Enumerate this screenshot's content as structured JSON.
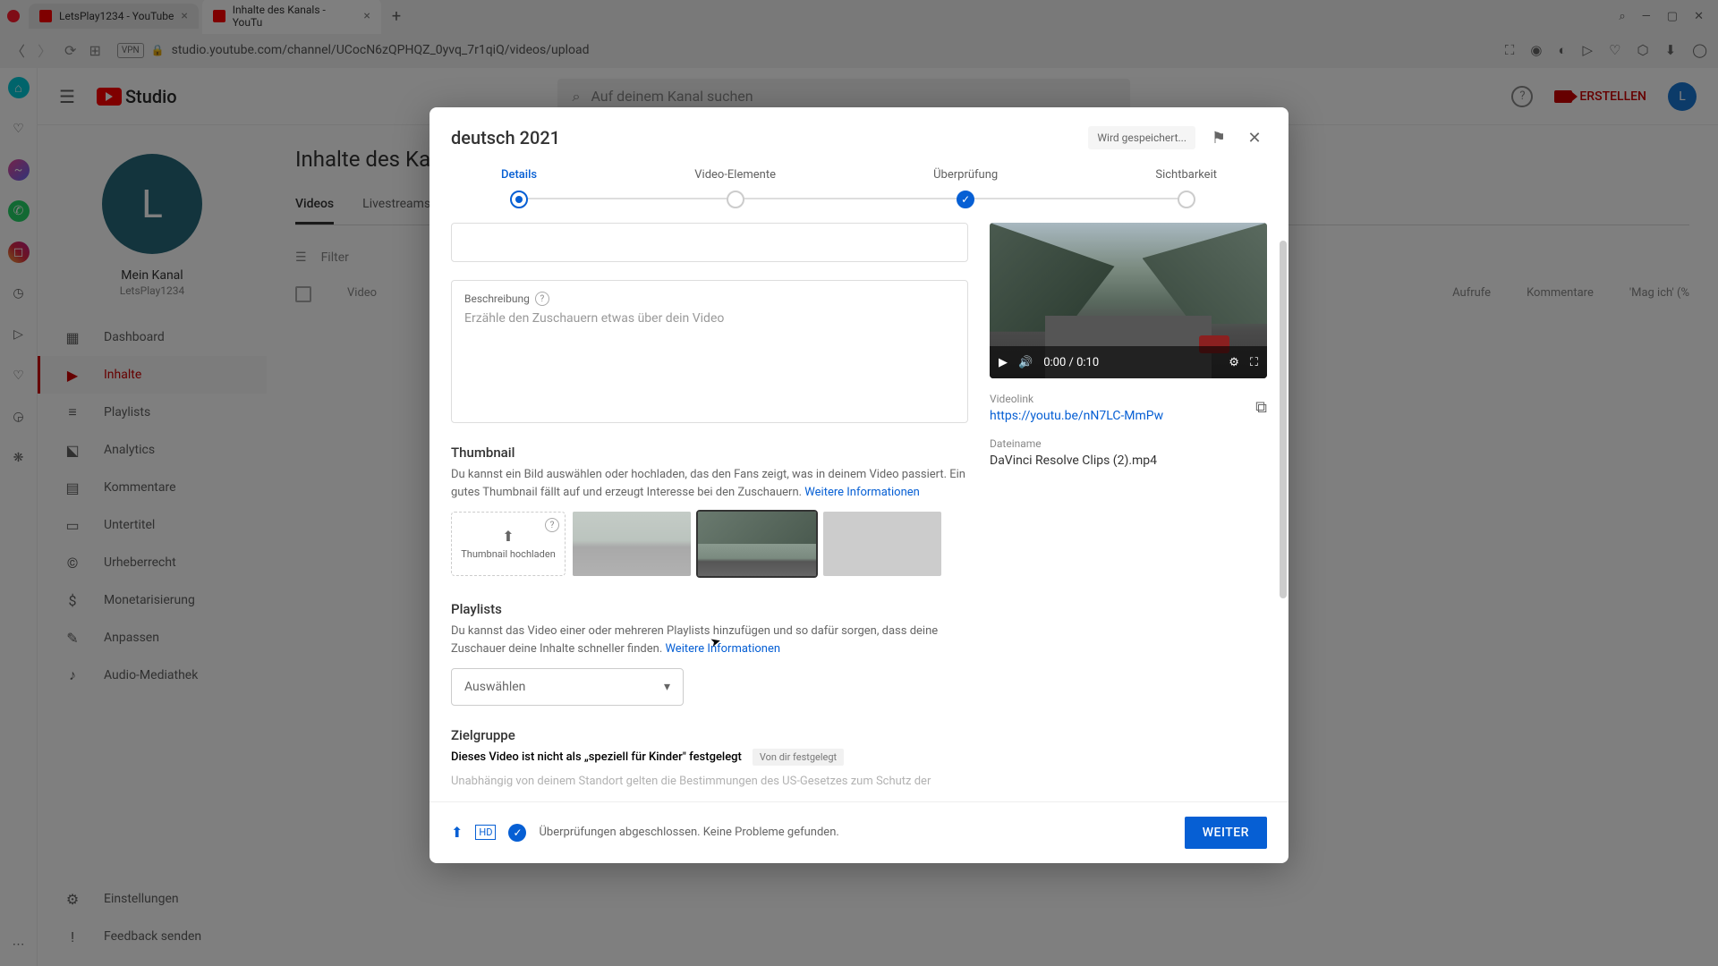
{
  "browser": {
    "tabs": [
      {
        "title": "LetsPlay1234 - YouTube",
        "active": false
      },
      {
        "title": "Inhalte des Kanals - YouTu",
        "active": true
      }
    ],
    "url": "studio.youtube.com/channel/UCocN6zQPHQZ_0yvq_7r1qiQ/videos/upload",
    "vpn": "VPN"
  },
  "header": {
    "logo_text": "Studio",
    "search_placeholder": "Auf deinem Kanal suchen",
    "create_label": "ERSTELLEN",
    "avatar_letter": "L"
  },
  "sidebar": {
    "avatar_letter": "L",
    "channel_name": "Mein Kanal",
    "channel_handle": "LetsPlay1234",
    "items": [
      {
        "label": "Dashboard",
        "icon": "▦"
      },
      {
        "label": "Inhalte",
        "icon": "▶",
        "active": true
      },
      {
        "label": "Playlists",
        "icon": "≡"
      },
      {
        "label": "Analytics",
        "icon": "⬕"
      },
      {
        "label": "Kommentare",
        "icon": "▤"
      },
      {
        "label": "Untertitel",
        "icon": "▭"
      },
      {
        "label": "Urheberrecht",
        "icon": "©"
      },
      {
        "label": "Monetarisierung",
        "icon": "$"
      },
      {
        "label": "Anpassen",
        "icon": "✎"
      },
      {
        "label": "Audio-Mediathek",
        "icon": "♪"
      }
    ],
    "bottom": [
      {
        "label": "Einstellungen",
        "icon": "⚙"
      },
      {
        "label": "Feedback senden",
        "icon": "!"
      }
    ]
  },
  "content": {
    "title": "Inhalte des Kana",
    "tabs": [
      {
        "label": "Videos",
        "active": true
      },
      {
        "label": "Livestreams"
      }
    ],
    "filter": "Filter",
    "cols": {
      "video": "Video",
      "views": "Aufrufe",
      "comments": "Kommentare",
      "likes": "'Mag ich' (%"
    }
  },
  "dialog": {
    "title": "deutsch 2021",
    "saving": "Wird gespeichert...",
    "steps": [
      {
        "label": "Details",
        "state": "act"
      },
      {
        "label": "Video-Elemente",
        "state": ""
      },
      {
        "label": "Überprüfung",
        "state": "done"
      },
      {
        "label": "Sichtbarkeit",
        "state": ""
      }
    ],
    "desc_label": "Beschreibung",
    "desc_placeholder": "Erzähle den Zuschauern etwas über dein Video",
    "thumb": {
      "title": "Thumbnail",
      "desc": "Du kannst ein Bild auswählen oder hochladen, das den Fans zeigt, was in deinem Video passiert. Ein gutes Thumbnail fällt auf und erzeugt Interesse bei den Zuschauern. ",
      "link": "Weitere Informationen",
      "upload": "Thumbnail hochladen"
    },
    "playlists": {
      "title": "Playlists",
      "desc": "Du kannst das Video einer oder mehreren Playlists hinzufügen und so dafür sorgen, dass deine Zuschauer deine Inhalte schneller finden. ",
      "link": "Weitere Informationen",
      "select": "Auswählen"
    },
    "audience": {
      "title": "Zielgruppe",
      "kids_text": "Dieses Video ist nicht als „speziell für Kinder\" festgelegt",
      "badge": "Von dir festgelegt",
      "law": "Unabhängig von deinem Standort gelten die Bestimmungen des US-Gesetzes zum Schutz der"
    },
    "preview": {
      "time": "0:00 / 0:10",
      "link_label": "Videolink",
      "link": "https://youtu.be/nN7LC-MmPw",
      "file_label": "Dateiname",
      "file": "DaVinci Resolve Clips (2).mp4"
    },
    "footer": {
      "text": "Überprüfungen abgeschlossen. Keine Probleme gefunden.",
      "next": "WEITER"
    }
  }
}
